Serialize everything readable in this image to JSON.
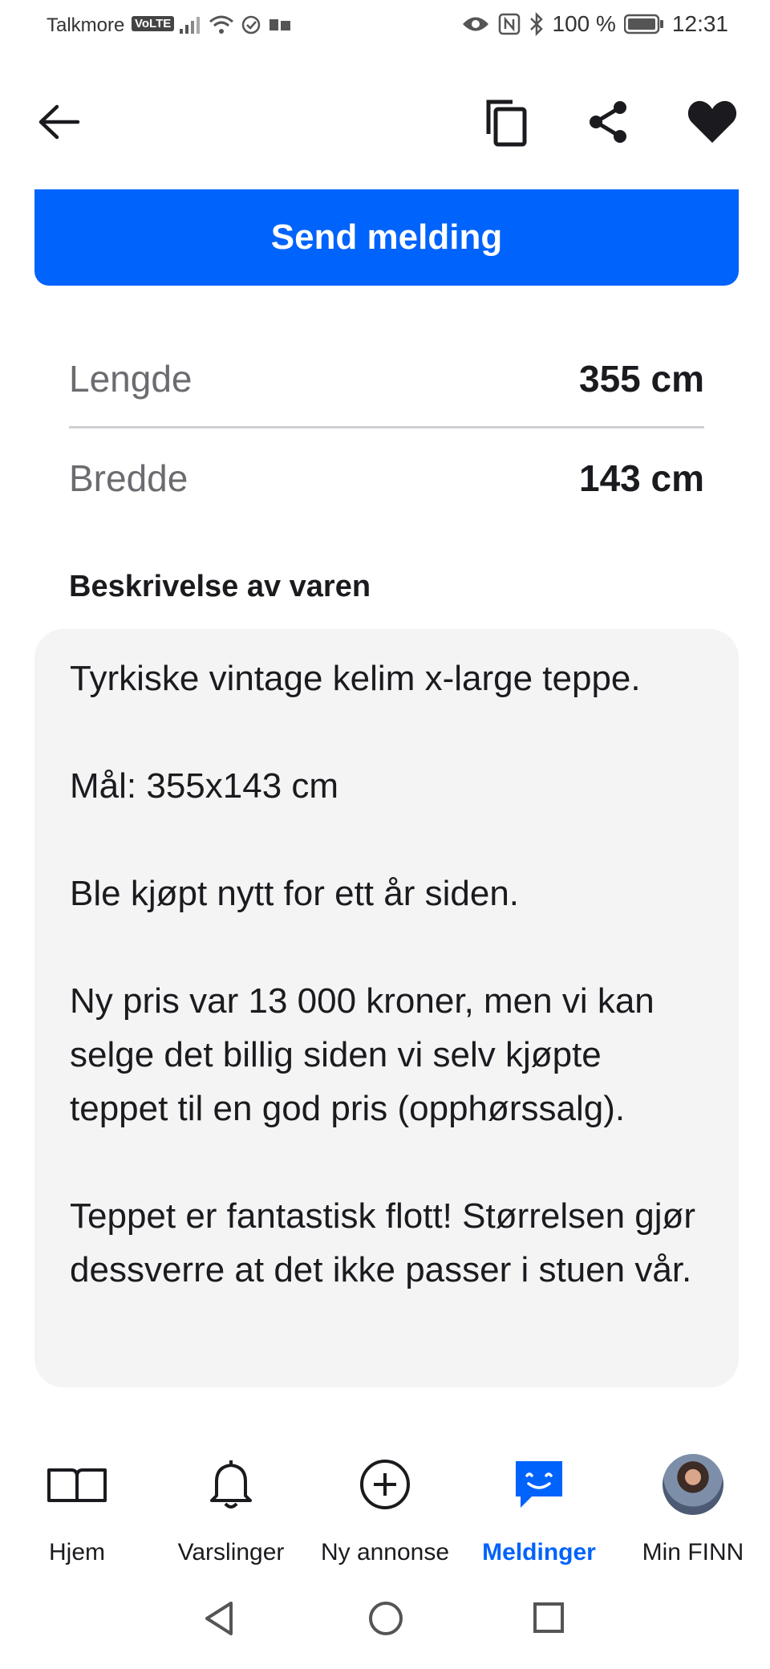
{
  "status_bar": {
    "carrier": "Talkmore",
    "volte": "VoLTE",
    "battery": "100 %",
    "time": "12:31"
  },
  "actions": {
    "send_message": "Send melding"
  },
  "specs": [
    {
      "label": "Lengde",
      "value": "355 cm"
    },
    {
      "label": "Bredde",
      "value": "143 cm"
    }
  ],
  "description": {
    "title": "Beskrivelse av varen",
    "paragraphs": [
      "Tyrkiske vintage kelim x-large teppe.",
      "Mål: 355x143 cm",
      "Ble kjøpt nytt for ett år siden.",
      "Ny pris var 13 000 kroner, men vi kan selge det billig siden vi selv kjøpte teppet til en god pris (opphørssalg).",
      "Teppet er fantastisk flott! Størrelsen gjør dessverre at det ikke passer i stuen vår."
    ]
  },
  "bottom_nav": [
    {
      "label": "Hjem",
      "icon": "book-icon"
    },
    {
      "label": "Varslinger",
      "icon": "bell-icon"
    },
    {
      "label": "Ny annonse",
      "icon": "plus-circle-icon"
    },
    {
      "label": "Meldinger",
      "icon": "chat-icon",
      "active": true
    },
    {
      "label": "Min FINN",
      "icon": "avatar"
    }
  ],
  "colors": {
    "accent": "#0063fb",
    "desc_background": "#f4f4f5"
  }
}
